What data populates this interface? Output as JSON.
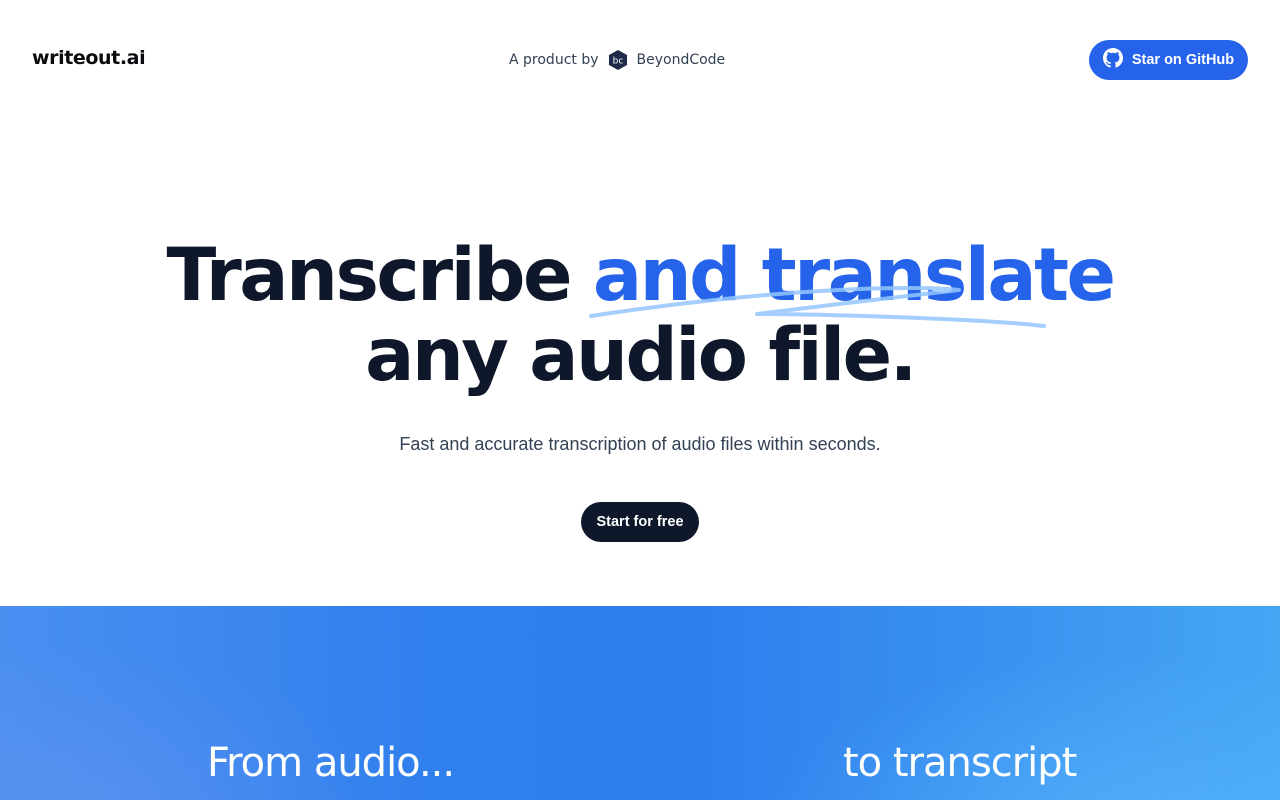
{
  "header": {
    "logo": "writeout.ai",
    "product_by_label": "A product by",
    "company_name": "BeyondCode",
    "company_badge_text": "bc",
    "github_button_label": "Star on GitHub",
    "github_icon": "github-icon"
  },
  "hero": {
    "headline_part1": "Transcribe ",
    "headline_accent": "and translate",
    "headline_line2": "any audio file.",
    "subtitle": "Fast and accurate transcription of audio files within seconds.",
    "cta_label": "Start for free"
  },
  "band": {
    "left_heading": "From audio...",
    "right_heading": "to transcript"
  },
  "colors": {
    "accent": "#2563eb",
    "dark": "#0f172a",
    "scribble": "#93c5fd"
  }
}
